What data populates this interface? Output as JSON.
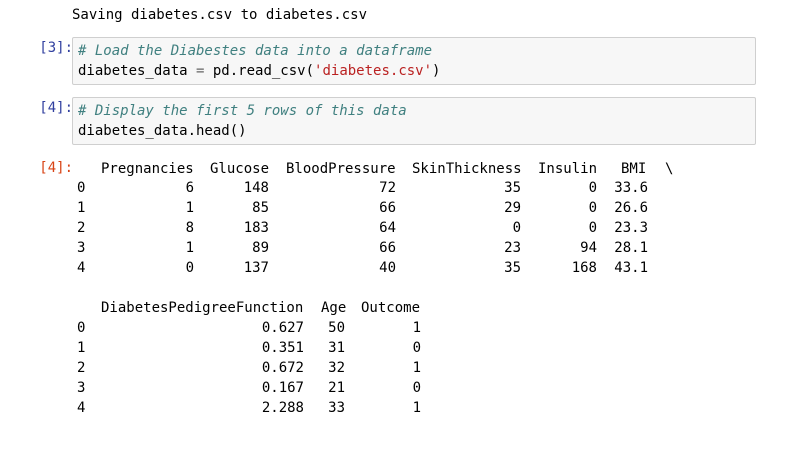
{
  "stream_output": "Saving diabetes.csv to diabetes.csv",
  "cells": [
    {
      "prompt": "[3]:",
      "comment": "# Load the Diabestes data into a dataframe",
      "code_pre": "diabetes_data ",
      "code_op": "=",
      "code_mid": " pd.read_csv(",
      "code_str": "'diabetes.csv'",
      "code_post": ")"
    },
    {
      "prompt": "[4]:",
      "comment": "# Display the first 5 rows of this data",
      "code": "diabetes_data.head()"
    }
  ],
  "output": {
    "prompt": "[4]:",
    "table1": {
      "headers": [
        "Pregnancies",
        "Glucose",
        "BloodPressure",
        "SkinThickness",
        "Insulin",
        "BMI",
        "\\"
      ],
      "index": [
        "0",
        "1",
        "2",
        "3",
        "4"
      ],
      "rows": [
        [
          "6",
          "148",
          "72",
          "35",
          "0",
          "33.6"
        ],
        [
          "1",
          "85",
          "66",
          "29",
          "0",
          "26.6"
        ],
        [
          "8",
          "183",
          "64",
          "0",
          "0",
          "23.3"
        ],
        [
          "1",
          "89",
          "66",
          "23",
          "94",
          "28.1"
        ],
        [
          "0",
          "137",
          "40",
          "35",
          "168",
          "43.1"
        ]
      ]
    },
    "table2": {
      "headers": [
        "DiabetesPedigreeFunction",
        "Age",
        "Outcome"
      ],
      "index": [
        "0",
        "1",
        "2",
        "3",
        "4"
      ],
      "rows": [
        [
          "0.627",
          "50",
          "1"
        ],
        [
          "0.351",
          "31",
          "0"
        ],
        [
          "0.672",
          "32",
          "1"
        ],
        [
          "0.167",
          "21",
          "0"
        ],
        [
          "2.288",
          "33",
          "1"
        ]
      ]
    }
  }
}
